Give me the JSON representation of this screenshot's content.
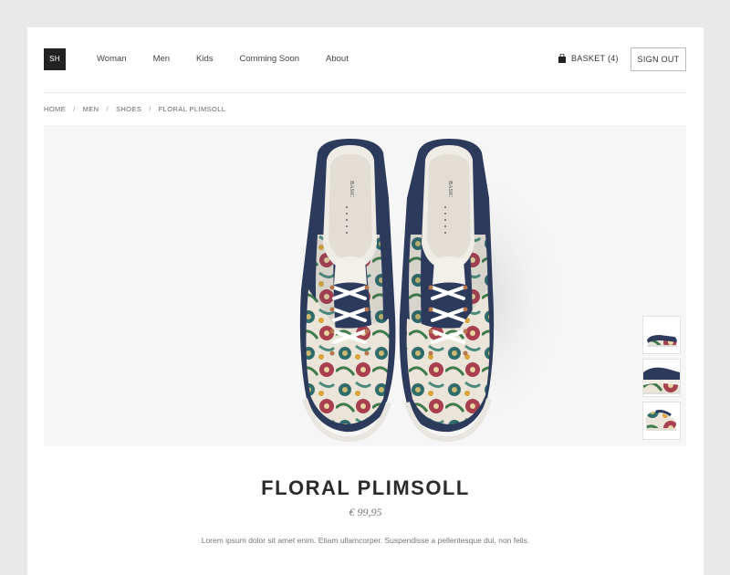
{
  "brand": {
    "logo_text": "SH"
  },
  "nav": {
    "items": [
      {
        "label": "Woman"
      },
      {
        "label": "Men"
      },
      {
        "label": "Kids"
      },
      {
        "label": "Comming Soon"
      },
      {
        "label": "About"
      }
    ]
  },
  "header": {
    "basket_label": "BASKET (4)",
    "basket_icon": "shopping-bag-icon",
    "sign_out_label": "SIGN OUT"
  },
  "breadcrumb": {
    "items": [
      "HOME",
      "MEN",
      "SHOES",
      "FLORAL PLIMSOLL"
    ],
    "separator": "/"
  },
  "product": {
    "name": "FLORAL PLIMSOLL",
    "price": "€ 99,95",
    "description": "Lorem ipsum dolor sit amet enim. Etiam ullamcorper. Suspendisse a pellentesque dui, non felis.",
    "insole_text": "BASIC ZARA MAN",
    "thumbnail_count": 3
  },
  "colors": {
    "page_bg": "#e9e9e9",
    "card_bg": "#ffffff",
    "logo_bg": "#222222",
    "shoe_navy": "#2c3a5c",
    "text_dark": "#2b2b2b"
  }
}
